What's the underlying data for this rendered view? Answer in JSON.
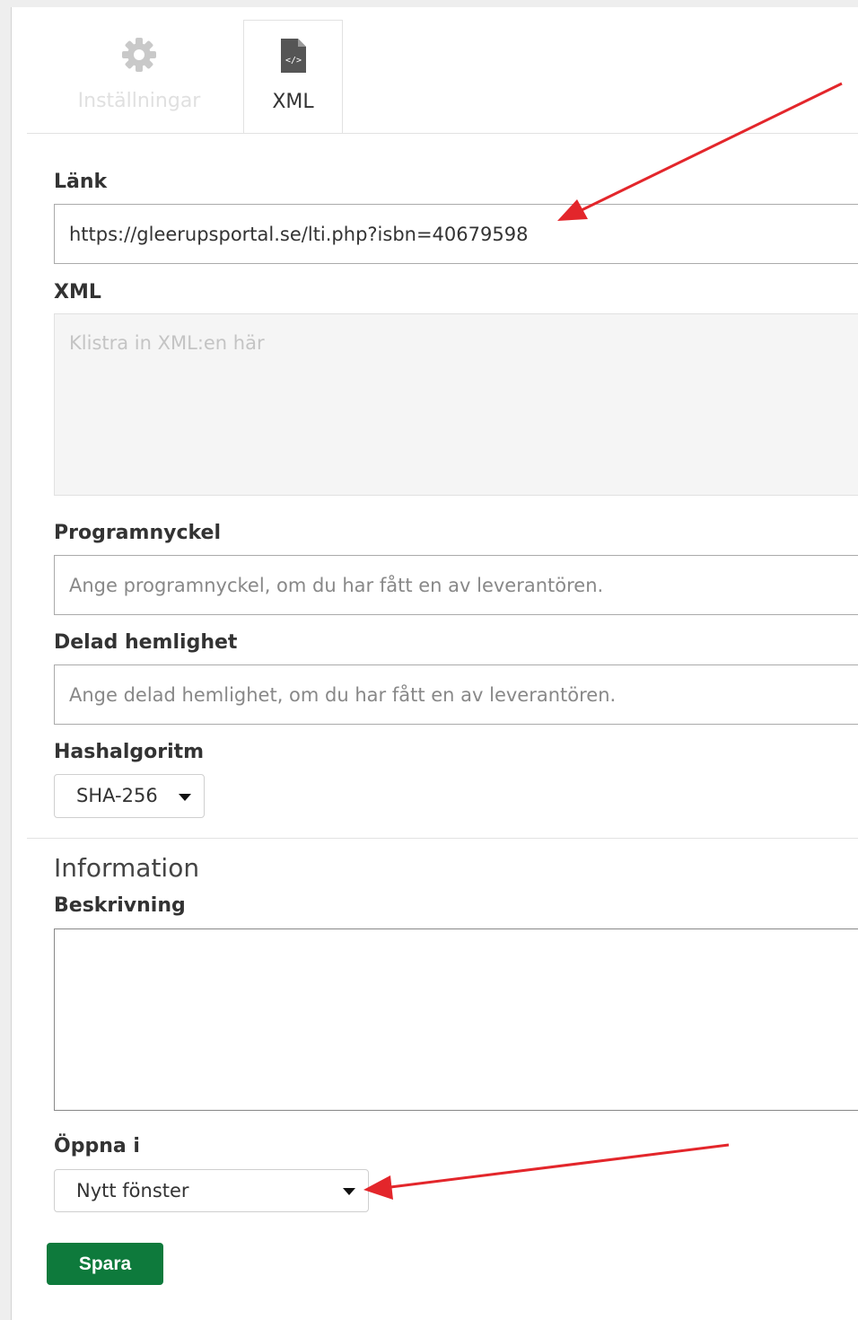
{
  "tabs": [
    {
      "label": "Inställningar",
      "icon": "gear-icon"
    },
    {
      "label": "XML",
      "icon": "code-file-icon"
    }
  ],
  "form": {
    "link_label": "Länk",
    "link_value": "https://gleerupsportal.se/lti.php?isbn=40679598",
    "xml_label": "XML",
    "xml_placeholder": "Klistra in XML:en här",
    "key_label": "Programnyckel",
    "key_placeholder": "Ange programnyckel, om du har fått en av leverantören.",
    "secret_label": "Delad hemlighet",
    "secret_placeholder": "Ange delad hemlighet, om du har fått en av leverantören.",
    "hash_label": "Hashalgoritm",
    "hash_value": "SHA-256"
  },
  "info": {
    "title": "Information",
    "description_label": "Beskrivning",
    "open_in_label": "Öppna i",
    "open_in_value": "Nytt fönster"
  },
  "save_label": "Spara",
  "colors": {
    "annotation": "#e3262b",
    "save": "#0e7a3c"
  }
}
